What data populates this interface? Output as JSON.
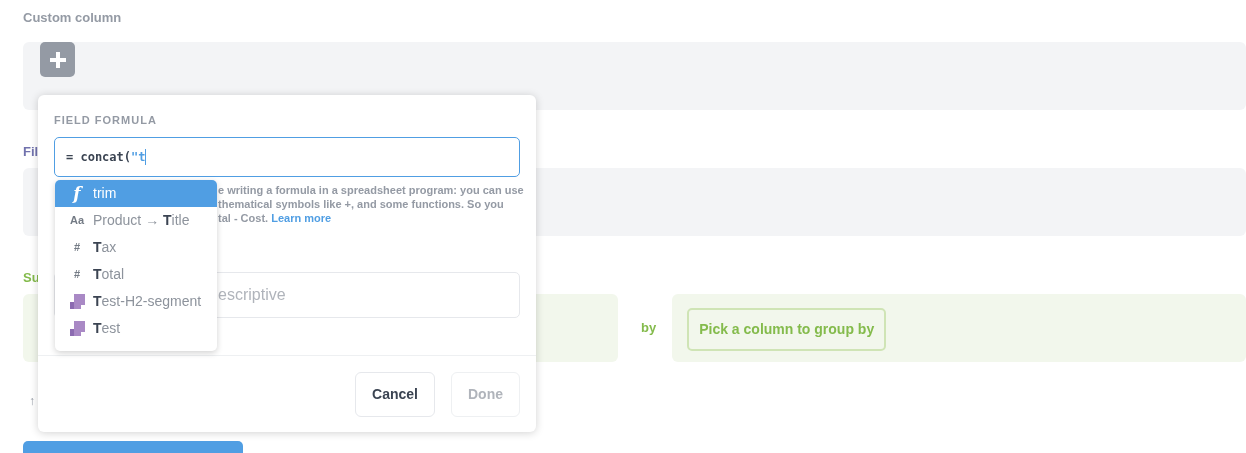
{
  "sections": [
    {
      "kind": "custom",
      "label": "Custom column"
    },
    {
      "kind": "filter",
      "label": "Fil"
    },
    {
      "kind": "summarize",
      "label": "Su",
      "by": "by",
      "group_button": "Pick a column to group by"
    }
  ],
  "sort_arrow": "↑",
  "popover": {
    "heading": "FIELD FORMULA",
    "formula": [
      {
        "kind": "code",
        "text": "= concat("
      },
      {
        "kind": "string",
        "text": "\"t"
      }
    ],
    "help_lines": [
      "e writing a formula in a spreadsheet program: you can use",
      "thematical symbols like +, and some functions. So you"
    ],
    "help_last": "tal - Cost.",
    "help_link": "Learn more",
    "name_placeholder": "escriptive",
    "cancel": "Cancel",
    "done": {
      "label": "Done",
      "disabled": true
    }
  },
  "suggestions": [
    {
      "kind": "function",
      "icon": "f",
      "label": "trim",
      "selected": true
    },
    {
      "kind": "string",
      "icon": "Aa",
      "label": "Product → **T**itle",
      "selected": false
    },
    {
      "kind": "number",
      "icon": "#",
      "label": "**T**ax",
      "selected": false
    },
    {
      "kind": "number",
      "icon": "#",
      "label": "**T**otal",
      "selected": false
    },
    {
      "kind": "segment",
      "label": "**T**est-H2-segment",
      "selected": false
    },
    {
      "kind": "segment",
      "label": "**T**est",
      "selected": false
    }
  ]
}
